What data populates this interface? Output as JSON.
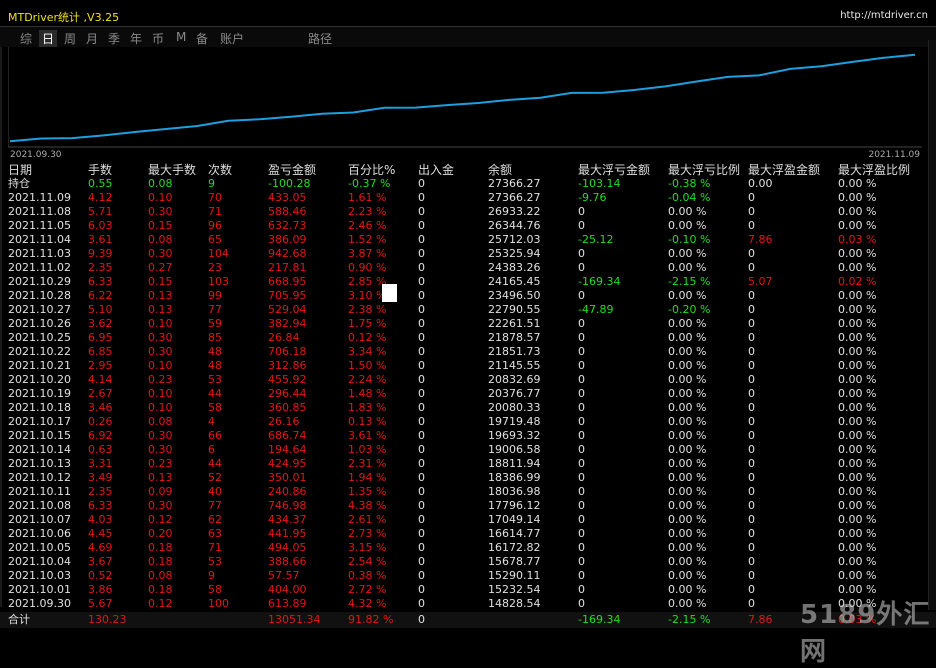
{
  "window": {
    "title": "MTDriver统计 ,V3.25",
    "url": "http://mtdriver.cn"
  },
  "tabs": [
    "综",
    "日",
    "周",
    "月",
    "季",
    "年",
    "币",
    "M",
    "备",
    "账户",
    "路径"
  ],
  "active_tab": "日",
  "chart": {
    "start_label": "2021.09.30",
    "end_label": "2021.11.09",
    "line_color": "#1e9fe0",
    "balance_series": [
      14828.54,
      15232.54,
      15290.11,
      15678.77,
      16172.82,
      16614.77,
      17049.14,
      17796.12,
      18036.98,
      18386.99,
      18811.94,
      19006.58,
      19693.32,
      19719.48,
      20080.33,
      20376.77,
      20832.69,
      21145.55,
      21851.73,
      21878.57,
      22261.51,
      22790.55,
      23496.5,
      24165.45,
      24383.26,
      25325.94,
      25712.03,
      26344.76,
      26933.22,
      27366.27
    ]
  },
  "columns": [
    "日期",
    "手数",
    "最大手数",
    "次数",
    "盈亏金额",
    "百分比%",
    "出入金",
    "余额",
    "最大浮亏金额",
    "最大浮亏比例",
    "最大浮盈金额",
    "最大浮盈比例"
  ],
  "holding": {
    "label": "持仓",
    "lots": "0.55",
    "max_lots": "0.08",
    "count": "9",
    "pnl": "-100.28",
    "pct": "-0.37 %",
    "flow": "0",
    "balance": "27366.27",
    "max_float_loss": "-103.14",
    "max_float_loss_pct": "-0.38 %",
    "max_float_profit": "0.00",
    "max_float_profit_pct": "0.00 %"
  },
  "rows": [
    {
      "date": "2021.11.09",
      "lots": "4.12",
      "max_lots": "0.10",
      "count": "70",
      "pnl": "433.05",
      "pct": "1.61 %",
      "flow": "0",
      "balance": "27366.27",
      "mfl": "-9.76",
      "mflp": "-0.04 %",
      "mfp": "0",
      "mfpp": "0.00 %"
    },
    {
      "date": "2021.11.08",
      "lots": "5.71",
      "max_lots": "0.30",
      "count": "71",
      "pnl": "588.46",
      "pct": "2.23 %",
      "flow": "0",
      "balance": "26933.22",
      "mfl": "0",
      "mflp": "0.00 %",
      "mfp": "0",
      "mfpp": "0.00 %"
    },
    {
      "date": "2021.11.05",
      "lots": "6.03",
      "max_lots": "0.15",
      "count": "96",
      "pnl": "632.73",
      "pct": "2.46 %",
      "flow": "0",
      "balance": "26344.76",
      "mfl": "0",
      "mflp": "0.00 %",
      "mfp": "0",
      "mfpp": "0.00 %"
    },
    {
      "date": "2021.11.04",
      "lots": "3.61",
      "max_lots": "0.08",
      "count": "65",
      "pnl": "386.09",
      "pct": "1.52 %",
      "flow": "0",
      "balance": "25712.03",
      "mfl": "-25.12",
      "mflp": "-0.10 %",
      "mfp": "7.86",
      "mfpp": "0.03 %"
    },
    {
      "date": "2021.11.03",
      "lots": "9.39",
      "max_lots": "0.30",
      "count": "104",
      "pnl": "942.68",
      "pct": "3.87 %",
      "flow": "0",
      "balance": "25325.94",
      "mfl": "0",
      "mflp": "0.00 %",
      "mfp": "0",
      "mfpp": "0.00 %"
    },
    {
      "date": "2021.11.02",
      "lots": "2.35",
      "max_lots": "0.27",
      "count": "23",
      "pnl": "217.81",
      "pct": "0.90 %",
      "flow": "0",
      "balance": "24383.26",
      "mfl": "0",
      "mflp": "0.00 %",
      "mfp": "0",
      "mfpp": "0.00 %"
    },
    {
      "date": "2021.10.29",
      "lots": "6.33",
      "max_lots": "0.15",
      "count": "103",
      "pnl": "668.95",
      "pct": "2.85 %",
      "flow": "0",
      "balance": "24165.45",
      "mfl": "-169.34",
      "mflp": "-2.15 %",
      "mfp": "5.07",
      "mfpp": "0.02 %"
    },
    {
      "date": "2021.10.28",
      "lots": "6.22",
      "max_lots": "0.13",
      "count": "99",
      "pnl": "705.95",
      "pct": "3.10 %",
      "flow": "0",
      "balance": "23496.50",
      "mfl": "0",
      "mflp": "0.00 %",
      "mfp": "0",
      "mfpp": "0.00 %"
    },
    {
      "date": "2021.10.27",
      "lots": "5.10",
      "max_lots": "0.13",
      "count": "77",
      "pnl": "529.04",
      "pct": "2.38 %",
      "flow": "0",
      "balance": "22790.55",
      "mfl": "-47.89",
      "mflp": "-0.20 %",
      "mfp": "0",
      "mfpp": "0.00 %"
    },
    {
      "date": "2021.10.26",
      "lots": "3.62",
      "max_lots": "0.10",
      "count": "59",
      "pnl": "382.94",
      "pct": "1.75 %",
      "flow": "0",
      "balance": "22261.51",
      "mfl": "0",
      "mflp": "0.00 %",
      "mfp": "0",
      "mfpp": "0.00 %"
    },
    {
      "date": "2021.10.25",
      "lots": "6.95",
      "max_lots": "0.30",
      "count": "85",
      "pnl": "26.84",
      "pct": "0.12 %",
      "flow": "0",
      "balance": "21878.57",
      "mfl": "0",
      "mflp": "0.00 %",
      "mfp": "0",
      "mfpp": "0.00 %"
    },
    {
      "date": "2021.10.22",
      "lots": "6.85",
      "max_lots": "0.30",
      "count": "48",
      "pnl": "706.18",
      "pct": "3.34 %",
      "flow": "0",
      "balance": "21851.73",
      "mfl": "0",
      "mflp": "0.00 %",
      "mfp": "0",
      "mfpp": "0.00 %"
    },
    {
      "date": "2021.10.21",
      "lots": "2.95",
      "max_lots": "0.10",
      "count": "48",
      "pnl": "312.86",
      "pct": "1.50 %",
      "flow": "0",
      "balance": "21145.55",
      "mfl": "0",
      "mflp": "0.00 %",
      "mfp": "0",
      "mfpp": "0.00 %"
    },
    {
      "date": "2021.10.20",
      "lots": "4.14",
      "max_lots": "0.23",
      "count": "53",
      "pnl": "455.92",
      "pct": "2.24 %",
      "flow": "0",
      "balance": "20832.69",
      "mfl": "0",
      "mflp": "0.00 %",
      "mfp": "0",
      "mfpp": "0.00 %"
    },
    {
      "date": "2021.10.19",
      "lots": "2.67",
      "max_lots": "0.10",
      "count": "44",
      "pnl": "296.44",
      "pct": "1.48 %",
      "flow": "0",
      "balance": "20376.77",
      "mfl": "0",
      "mflp": "0.00 %",
      "mfp": "0",
      "mfpp": "0.00 %"
    },
    {
      "date": "2021.10.18",
      "lots": "3.46",
      "max_lots": "0.10",
      "count": "58",
      "pnl": "360.85",
      "pct": "1.83 %",
      "flow": "0",
      "balance": "20080.33",
      "mfl": "0",
      "mflp": "0.00 %",
      "mfp": "0",
      "mfpp": "0.00 %"
    },
    {
      "date": "2021.10.17",
      "lots": "0.26",
      "max_lots": "0.08",
      "count": "4",
      "pnl": "26.16",
      "pct": "0.13 %",
      "flow": "0",
      "balance": "19719.48",
      "mfl": "0",
      "mflp": "0.00 %",
      "mfp": "0",
      "mfpp": "0.00 %"
    },
    {
      "date": "2021.10.15",
      "lots": "6.92",
      "max_lots": "0.30",
      "count": "66",
      "pnl": "686.74",
      "pct": "3.61 %",
      "flow": "0",
      "balance": "19693.32",
      "mfl": "0",
      "mflp": "0.00 %",
      "mfp": "0",
      "mfpp": "0.00 %"
    },
    {
      "date": "2021.10.14",
      "lots": "0.63",
      "max_lots": "0.30",
      "count": "6",
      "pnl": "194.64",
      "pct": "1.03 %",
      "flow": "0",
      "balance": "19006.58",
      "mfl": "0",
      "mflp": "0.00 %",
      "mfp": "0",
      "mfpp": "0.00 %"
    },
    {
      "date": "2021.10.13",
      "lots": "3.31",
      "max_lots": "0.23",
      "count": "44",
      "pnl": "424.95",
      "pct": "2.31 %",
      "flow": "0",
      "balance": "18811.94",
      "mfl": "0",
      "mflp": "0.00 %",
      "mfp": "0",
      "mfpp": "0.00 %"
    },
    {
      "date": "2021.10.12",
      "lots": "3.49",
      "max_lots": "0.13",
      "count": "52",
      "pnl": "350.01",
      "pct": "1.94 %",
      "flow": "0",
      "balance": "18386.99",
      "mfl": "0",
      "mflp": "0.00 %",
      "mfp": "0",
      "mfpp": "0.00 %"
    },
    {
      "date": "2021.10.11",
      "lots": "2.35",
      "max_lots": "0.09",
      "count": "40",
      "pnl": "240.86",
      "pct": "1.35 %",
      "flow": "0",
      "balance": "18036.98",
      "mfl": "0",
      "mflp": "0.00 %",
      "mfp": "0",
      "mfpp": "0.00 %"
    },
    {
      "date": "2021.10.08",
      "lots": "6.33",
      "max_lots": "0.30",
      "count": "77",
      "pnl": "746.98",
      "pct": "4.38 %",
      "flow": "0",
      "balance": "17796.12",
      "mfl": "0",
      "mflp": "0.00 %",
      "mfp": "0",
      "mfpp": "0.00 %"
    },
    {
      "date": "2021.10.07",
      "lots": "4.03",
      "max_lots": "0.12",
      "count": "62",
      "pnl": "434.37",
      "pct": "2.61 %",
      "flow": "0",
      "balance": "17049.14",
      "mfl": "0",
      "mflp": "0.00 %",
      "mfp": "0",
      "mfpp": "0.00 %"
    },
    {
      "date": "2021.10.06",
      "lots": "4.45",
      "max_lots": "0.20",
      "count": "63",
      "pnl": "441.95",
      "pct": "2.73 %",
      "flow": "0",
      "balance": "16614.77",
      "mfl": "0",
      "mflp": "0.00 %",
      "mfp": "0",
      "mfpp": "0.00 %"
    },
    {
      "date": "2021.10.05",
      "lots": "4.69",
      "max_lots": "0.18",
      "count": "71",
      "pnl": "494.05",
      "pct": "3.15 %",
      "flow": "0",
      "balance": "16172.82",
      "mfl": "0",
      "mflp": "0.00 %",
      "mfp": "0",
      "mfpp": "0.00 %"
    },
    {
      "date": "2021.10.04",
      "lots": "3.67",
      "max_lots": "0.18",
      "count": "53",
      "pnl": "388.66",
      "pct": "2.54 %",
      "flow": "0",
      "balance": "15678.77",
      "mfl": "0",
      "mflp": "0.00 %",
      "mfp": "0",
      "mfpp": "0.00 %"
    },
    {
      "date": "2021.10.03",
      "lots": "0.52",
      "max_lots": "0.08",
      "count": "9",
      "pnl": "57.57",
      "pct": "0.38 %",
      "flow": "0",
      "balance": "15290.11",
      "mfl": "0",
      "mflp": "0.00 %",
      "mfp": "0",
      "mfpp": "0.00 %"
    },
    {
      "date": "2021.10.01",
      "lots": "3.86",
      "max_lots": "0.18",
      "count": "58",
      "pnl": "404.00",
      "pct": "2.72 %",
      "flow": "0",
      "balance": "15232.54",
      "mfl": "0",
      "mflp": "0.00 %",
      "mfp": "0",
      "mfpp": "0.00 %"
    },
    {
      "date": "2021.09.30",
      "lots": "5.67",
      "max_lots": "0.12",
      "count": "100",
      "pnl": "613.89",
      "pct": "4.32 %",
      "flow": "0",
      "balance": "14828.54",
      "mfl": "0",
      "mflp": "0.00 %",
      "mfp": "0",
      "mfpp": "0.00 %"
    }
  ],
  "total": {
    "label": "合计",
    "lots": "130.23",
    "pnl": "13051.34",
    "pct": "91.82 %",
    "flow": "0",
    "mfl": "-169.34",
    "mflp": "-2.15 %",
    "mfp": "7.86",
    "mfpp": "0.03 %"
  },
  "colors": {
    "profit": "#e01818",
    "loss": "#22dd22",
    "title": "#f0e020",
    "chart_line": "#1e9fe0"
  },
  "watermark": "5189外汇网"
}
